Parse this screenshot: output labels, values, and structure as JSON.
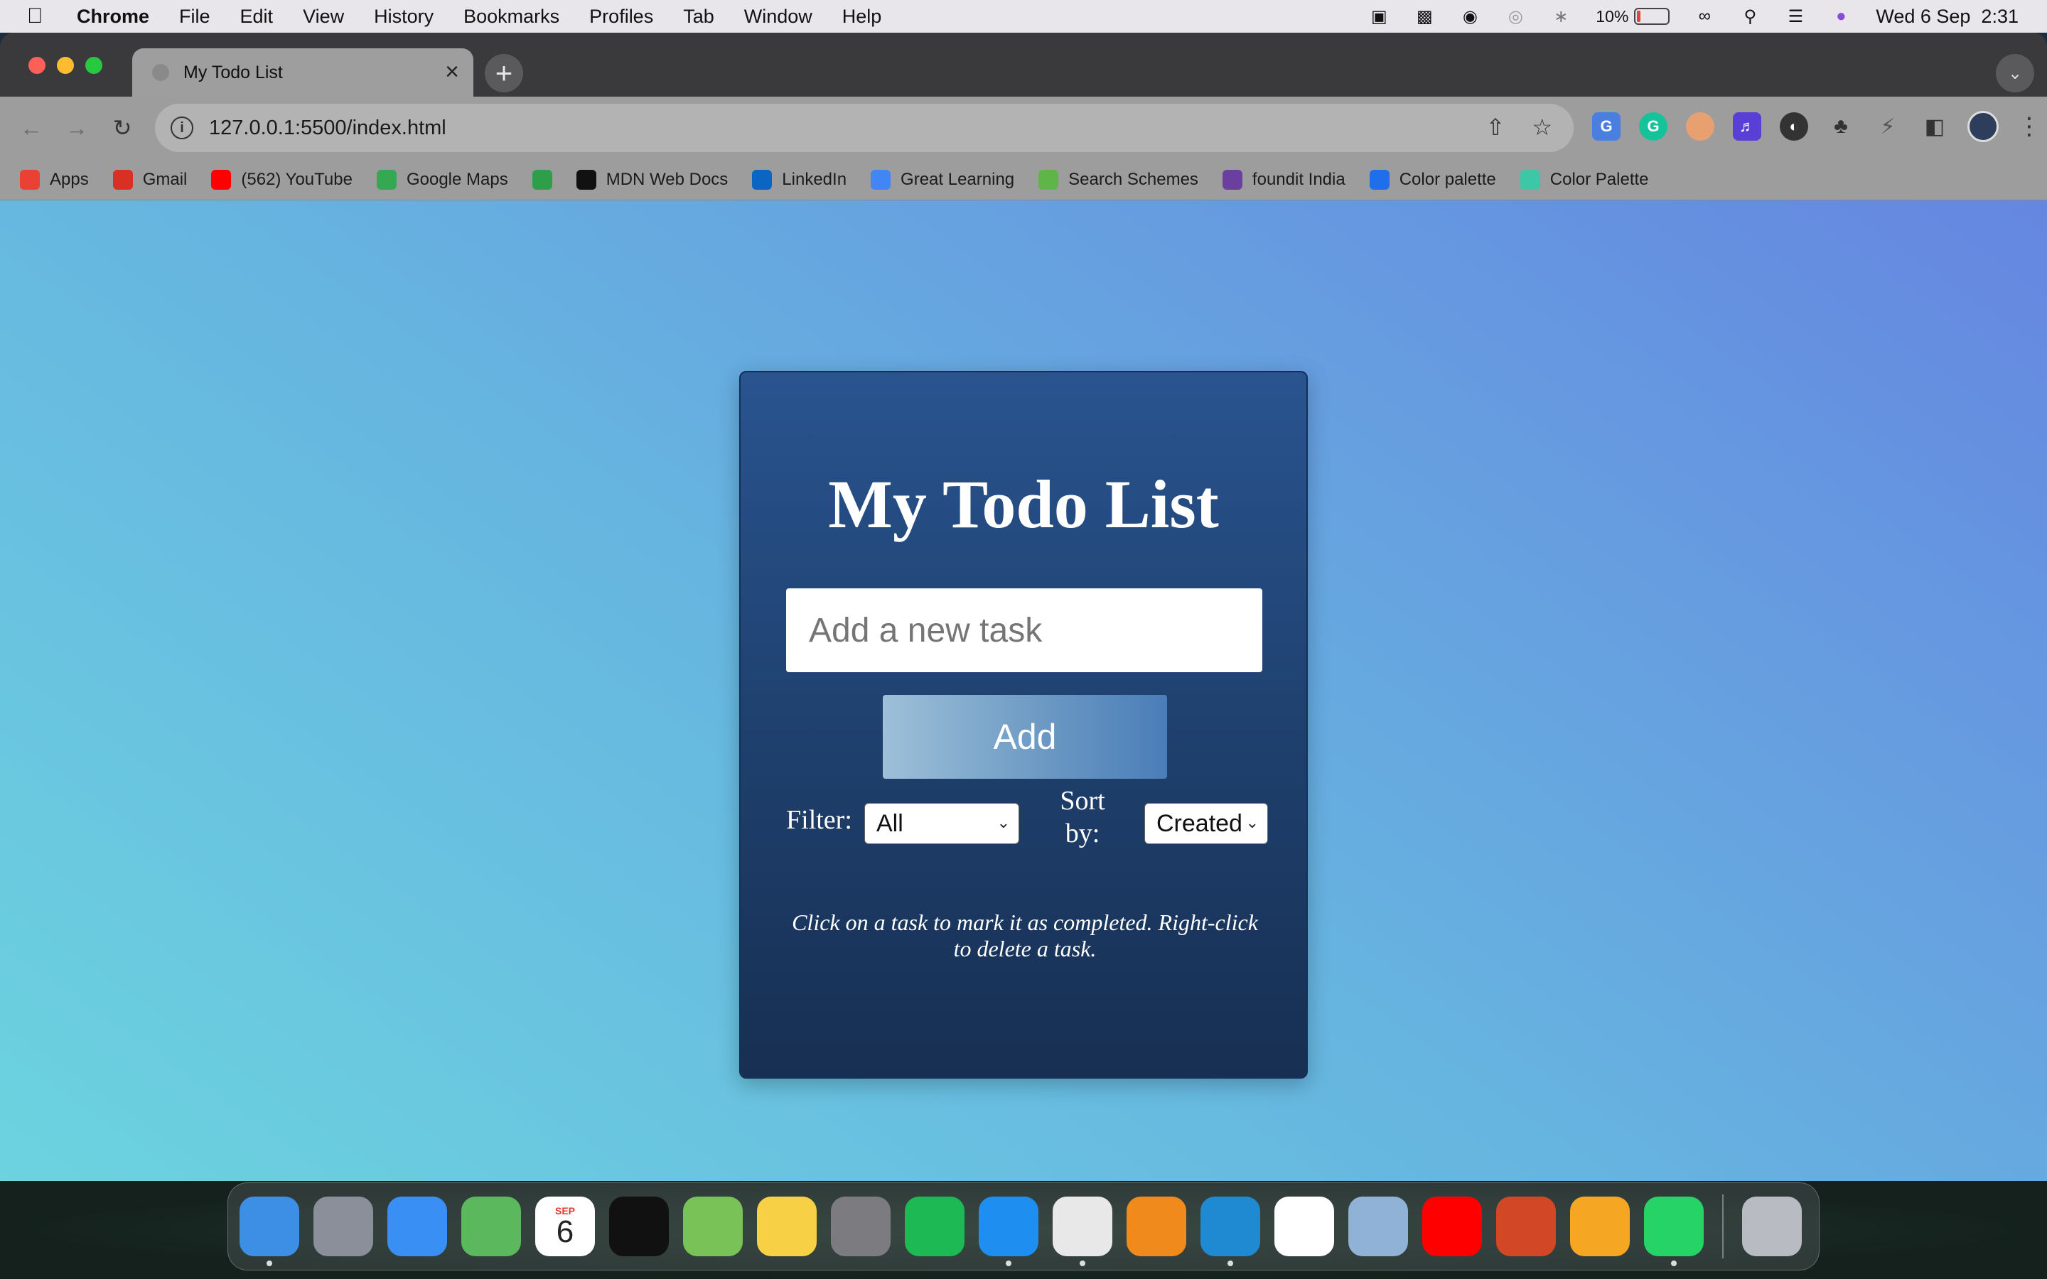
{
  "menubar": {
    "app_name": "Chrome",
    "items": [
      "File",
      "Edit",
      "View",
      "History",
      "Bookmarks",
      "Profiles",
      "Tab",
      "Window",
      "Help"
    ],
    "battery": "10%",
    "datetime": "Wed 6 Sep  2:31"
  },
  "browser": {
    "tab_title": "My Todo List",
    "url": "127.0.0.1:5500/index.html",
    "bookmarks": [
      {
        "label": "Apps",
        "icon": "apps-grid-icon",
        "color": "#e94235"
      },
      {
        "label": "Gmail",
        "icon": "gmail-icon",
        "color": "#d93025"
      },
      {
        "label": "(562) YouTube",
        "icon": "youtube-icon",
        "color": "#ff0000"
      },
      {
        "label": "Google Maps",
        "icon": "maps-pin-icon",
        "color": "#34a853"
      },
      {
        "label": "",
        "icon": "w-logo-icon",
        "color": "#2e9e4a"
      },
      {
        "label": "MDN Web Docs",
        "icon": "mdn-icon",
        "color": "#111111"
      },
      {
        "label": "LinkedIn",
        "icon": "linkedin-icon",
        "color": "#0a66c2"
      },
      {
        "label": "Great Learning",
        "icon": "google-g-icon",
        "color": "#4285f4"
      },
      {
        "label": "Search Schemes",
        "icon": "myscheme-icon",
        "color": "#5fb548"
      },
      {
        "label": "foundit India",
        "icon": "foundit-icon",
        "color": "#6b3fa0"
      },
      {
        "label": "Color palette",
        "icon": "coolors-icon",
        "color": "#1f6feb"
      },
      {
        "label": "Color Palette",
        "icon": "palette-icon",
        "color": "#3cc7a6"
      }
    ]
  },
  "app": {
    "title": "My Todo List",
    "input_placeholder": "Add a new task",
    "add_label": "Add",
    "filter_label": "Filter:",
    "filter_value": "All",
    "sort_label": "Sort by:",
    "sort_value": "Created",
    "hint": "Click on a task to mark it as completed. Right-click to delete a task."
  },
  "dock": {
    "apps": [
      {
        "name": "finder-icon",
        "color": "#3d8fe6",
        "running": true
      },
      {
        "name": "launchpad-icon",
        "color": "#8a8f99",
        "running": false
      },
      {
        "name": "mail-icon",
        "color": "#3a8ff5",
        "running": false
      },
      {
        "name": "maps-icon",
        "color": "#5cb85c",
        "running": false
      },
      {
        "name": "calendar-icon",
        "color": "#ffffff",
        "running": false,
        "month": "SEP",
        "day": "6"
      },
      {
        "name": "apple-tv-icon",
        "color": "#111111",
        "running": false
      },
      {
        "name": "android-studio-icon",
        "color": "#78c257",
        "running": false
      },
      {
        "name": "notes-icon",
        "color": "#f7d046",
        "running": false
      },
      {
        "name": "system-settings-icon",
        "color": "#7c7c80",
        "running": false
      },
      {
        "name": "spotify-icon",
        "color": "#1db954",
        "running": false
      },
      {
        "name": "safari-icon",
        "color": "#1f8ef1",
        "running": true
      },
      {
        "name": "chrome-icon",
        "color": "#e8e8e8",
        "running": true
      },
      {
        "name": "vlc-icon",
        "color": "#f08a1c",
        "running": false
      },
      {
        "name": "vscode-icon",
        "color": "#1f8ad2",
        "running": true
      },
      {
        "name": "notion-icon",
        "color": "#ffffff",
        "running": false
      },
      {
        "name": "preview-icon",
        "color": "#8fb2d6",
        "running": false
      },
      {
        "name": "youtube-app-icon",
        "color": "#ff0000",
        "running": false
      },
      {
        "name": "powerpoint-icon",
        "color": "#d24726",
        "running": false
      },
      {
        "name": "pages-icon",
        "color": "#f5a623",
        "running": false
      },
      {
        "name": "whatsapp-icon",
        "color": "#25d366",
        "running": true
      }
    ],
    "trash": {
      "name": "trash-icon",
      "color": "#b8bcc2"
    }
  }
}
